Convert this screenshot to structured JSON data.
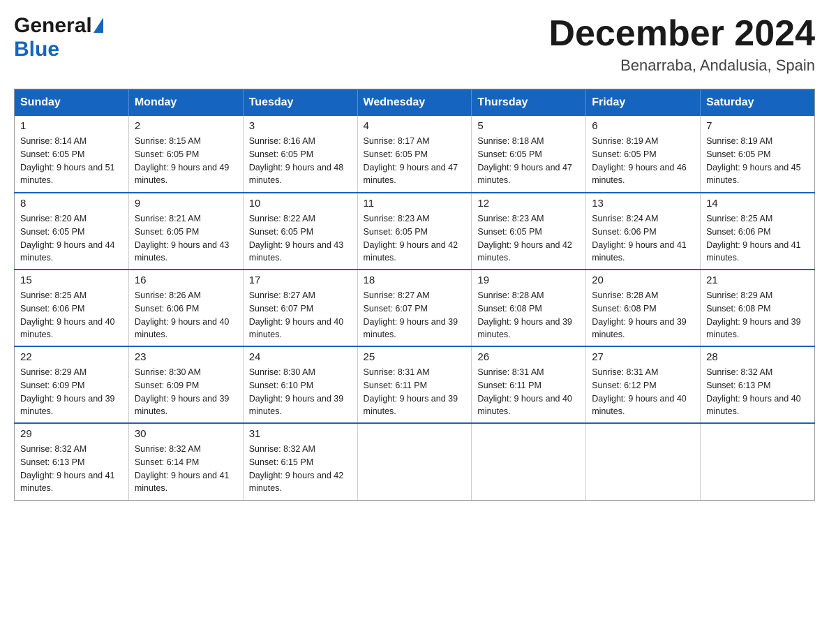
{
  "logo": {
    "general": "General",
    "blue": "Blue",
    "arrow": "▶"
  },
  "title": {
    "month": "December 2024",
    "location": "Benarraba, Andalusia, Spain"
  },
  "days_header": [
    "Sunday",
    "Monday",
    "Tuesday",
    "Wednesday",
    "Thursday",
    "Friday",
    "Saturday"
  ],
  "weeks": [
    [
      {
        "num": "1",
        "sunrise": "8:14 AM",
        "sunset": "6:05 PM",
        "daylight": "9 hours and 51 minutes."
      },
      {
        "num": "2",
        "sunrise": "8:15 AM",
        "sunset": "6:05 PM",
        "daylight": "9 hours and 49 minutes."
      },
      {
        "num": "3",
        "sunrise": "8:16 AM",
        "sunset": "6:05 PM",
        "daylight": "9 hours and 48 minutes."
      },
      {
        "num": "4",
        "sunrise": "8:17 AM",
        "sunset": "6:05 PM",
        "daylight": "9 hours and 47 minutes."
      },
      {
        "num": "5",
        "sunrise": "8:18 AM",
        "sunset": "6:05 PM",
        "daylight": "9 hours and 47 minutes."
      },
      {
        "num": "6",
        "sunrise": "8:19 AM",
        "sunset": "6:05 PM",
        "daylight": "9 hours and 46 minutes."
      },
      {
        "num": "7",
        "sunrise": "8:19 AM",
        "sunset": "6:05 PM",
        "daylight": "9 hours and 45 minutes."
      }
    ],
    [
      {
        "num": "8",
        "sunrise": "8:20 AM",
        "sunset": "6:05 PM",
        "daylight": "9 hours and 44 minutes."
      },
      {
        "num": "9",
        "sunrise": "8:21 AM",
        "sunset": "6:05 PM",
        "daylight": "9 hours and 43 minutes."
      },
      {
        "num": "10",
        "sunrise": "8:22 AM",
        "sunset": "6:05 PM",
        "daylight": "9 hours and 43 minutes."
      },
      {
        "num": "11",
        "sunrise": "8:23 AM",
        "sunset": "6:05 PM",
        "daylight": "9 hours and 42 minutes."
      },
      {
        "num": "12",
        "sunrise": "8:23 AM",
        "sunset": "6:05 PM",
        "daylight": "9 hours and 42 minutes."
      },
      {
        "num": "13",
        "sunrise": "8:24 AM",
        "sunset": "6:06 PM",
        "daylight": "9 hours and 41 minutes."
      },
      {
        "num": "14",
        "sunrise": "8:25 AM",
        "sunset": "6:06 PM",
        "daylight": "9 hours and 41 minutes."
      }
    ],
    [
      {
        "num": "15",
        "sunrise": "8:25 AM",
        "sunset": "6:06 PM",
        "daylight": "9 hours and 40 minutes."
      },
      {
        "num": "16",
        "sunrise": "8:26 AM",
        "sunset": "6:06 PM",
        "daylight": "9 hours and 40 minutes."
      },
      {
        "num": "17",
        "sunrise": "8:27 AM",
        "sunset": "6:07 PM",
        "daylight": "9 hours and 40 minutes."
      },
      {
        "num": "18",
        "sunrise": "8:27 AM",
        "sunset": "6:07 PM",
        "daylight": "9 hours and 39 minutes."
      },
      {
        "num": "19",
        "sunrise": "8:28 AM",
        "sunset": "6:08 PM",
        "daylight": "9 hours and 39 minutes."
      },
      {
        "num": "20",
        "sunrise": "8:28 AM",
        "sunset": "6:08 PM",
        "daylight": "9 hours and 39 minutes."
      },
      {
        "num": "21",
        "sunrise": "8:29 AM",
        "sunset": "6:08 PM",
        "daylight": "9 hours and 39 minutes."
      }
    ],
    [
      {
        "num": "22",
        "sunrise": "8:29 AM",
        "sunset": "6:09 PM",
        "daylight": "9 hours and 39 minutes."
      },
      {
        "num": "23",
        "sunrise": "8:30 AM",
        "sunset": "6:09 PM",
        "daylight": "9 hours and 39 minutes."
      },
      {
        "num": "24",
        "sunrise": "8:30 AM",
        "sunset": "6:10 PM",
        "daylight": "9 hours and 39 minutes."
      },
      {
        "num": "25",
        "sunrise": "8:31 AM",
        "sunset": "6:11 PM",
        "daylight": "9 hours and 39 minutes."
      },
      {
        "num": "26",
        "sunrise": "8:31 AM",
        "sunset": "6:11 PM",
        "daylight": "9 hours and 40 minutes."
      },
      {
        "num": "27",
        "sunrise": "8:31 AM",
        "sunset": "6:12 PM",
        "daylight": "9 hours and 40 minutes."
      },
      {
        "num": "28",
        "sunrise": "8:32 AM",
        "sunset": "6:13 PM",
        "daylight": "9 hours and 40 minutes."
      }
    ],
    [
      {
        "num": "29",
        "sunrise": "8:32 AM",
        "sunset": "6:13 PM",
        "daylight": "9 hours and 41 minutes."
      },
      {
        "num": "30",
        "sunrise": "8:32 AM",
        "sunset": "6:14 PM",
        "daylight": "9 hours and 41 minutes."
      },
      {
        "num": "31",
        "sunrise": "8:32 AM",
        "sunset": "6:15 PM",
        "daylight": "9 hours and 42 minutes."
      },
      null,
      null,
      null,
      null
    ]
  ]
}
